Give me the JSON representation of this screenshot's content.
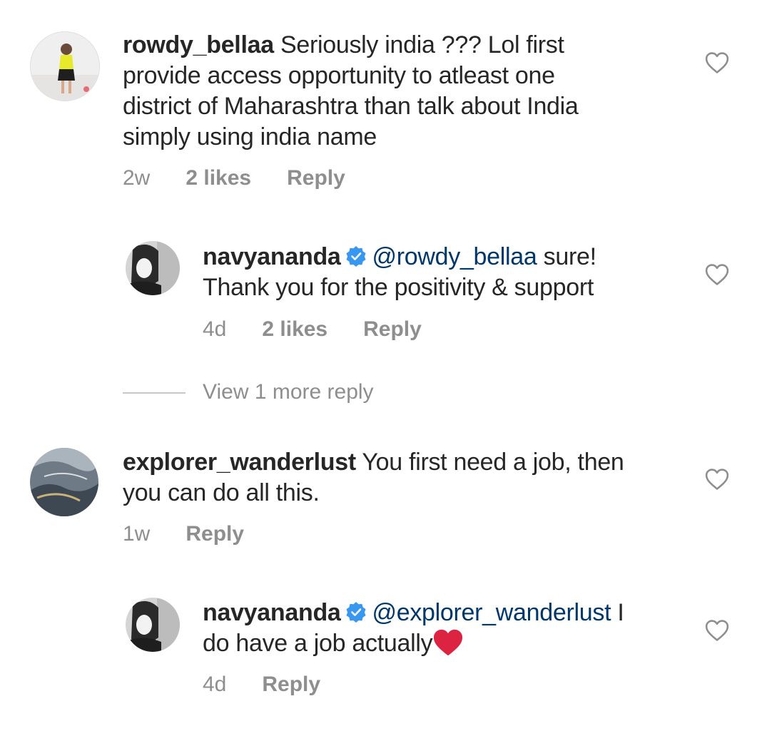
{
  "colors": {
    "text": "#262626",
    "meta": "#8e8e8e",
    "mention": "#00376b",
    "verified": "#3897f0",
    "emoji_heart": "#e0245e"
  },
  "comments": [
    {
      "username": "rowdy_bellaa",
      "text_lines": [
        "Seriously india ??? Lol  first",
        "provide access opportunity to atleast one",
        "district of Maharashtra than talk about India",
        "simply using india name"
      ],
      "time": "2w",
      "likes": "2 likes",
      "reply_label": "Reply",
      "avatar_icon": "avatar-photo"
    },
    {
      "username": "navyananda",
      "verified": true,
      "mention": "@rowdy_bellaa",
      "text_after_mention": "sure!",
      "text_line2": "Thank you for the positivity & support",
      "time": "4d",
      "likes": "2 likes",
      "reply_label": "Reply",
      "avatar_icon": "avatar-photo"
    },
    {
      "username": "explorer_wanderlust",
      "text_line1": "You first need a job, then",
      "text_line2": "you can do all this.",
      "time": "1w",
      "reply_label": "Reply",
      "avatar_icon": "avatar-photo"
    },
    {
      "username": "navyananda",
      "verified": true,
      "mention": "@explorer_wanderlust",
      "text_after_mention": "I",
      "text_line2": "do have a job actually",
      "emoji": "red-heart-emoji",
      "time": "4d",
      "reply_label": "Reply",
      "avatar_icon": "avatar-photo"
    }
  ],
  "view_more_replies": "View 1 more reply",
  "icons": {
    "like": "heart-outline-icon",
    "verified": "verified-badge-icon"
  }
}
